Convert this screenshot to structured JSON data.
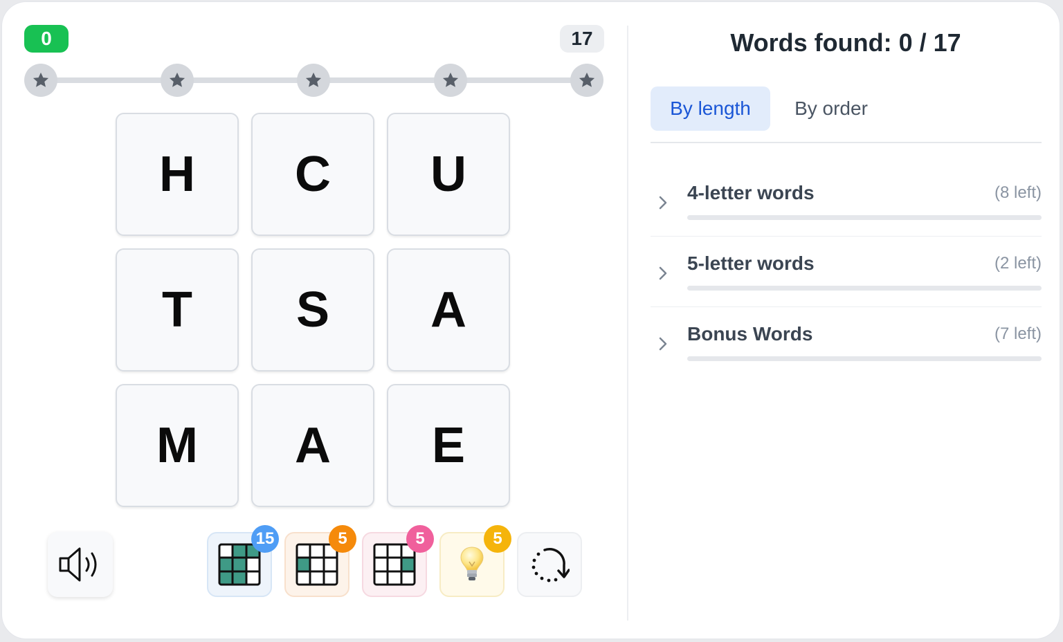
{
  "progress": {
    "score": "0",
    "target": "17",
    "milestones": [
      "star",
      "star",
      "star",
      "star",
      "star"
    ]
  },
  "grid": {
    "letters": [
      "H",
      "C",
      "U",
      "T",
      "S",
      "A",
      "M",
      "A",
      "E"
    ]
  },
  "tools": {
    "sound_icon": "speaker-icon",
    "reveal_grid_badge": "15",
    "reveal_column_badge": "5",
    "reveal_last_column_badge": "5",
    "hint_badge": "5",
    "shuffle_icon": "shuffle-icon"
  },
  "colors": {
    "score_green": "#18c153",
    "badge_blue": "#4f9df5",
    "badge_orange": "#f58a0b",
    "badge_pink": "#f0609c",
    "badge_yellow": "#f5b40b",
    "tab_active_text": "#1a56d6"
  },
  "panel": {
    "title": "Words found: 0 / 17",
    "tabs": [
      {
        "label": "By length",
        "active": true
      },
      {
        "label": "By order",
        "active": false
      }
    ],
    "sections": [
      {
        "label": "4-letter words",
        "remaining": "(8 left)",
        "progress": 0
      },
      {
        "label": "5-letter words",
        "remaining": "(2 left)",
        "progress": 0
      },
      {
        "label": "Bonus Words",
        "remaining": "(7 left)",
        "progress": 0
      }
    ]
  }
}
